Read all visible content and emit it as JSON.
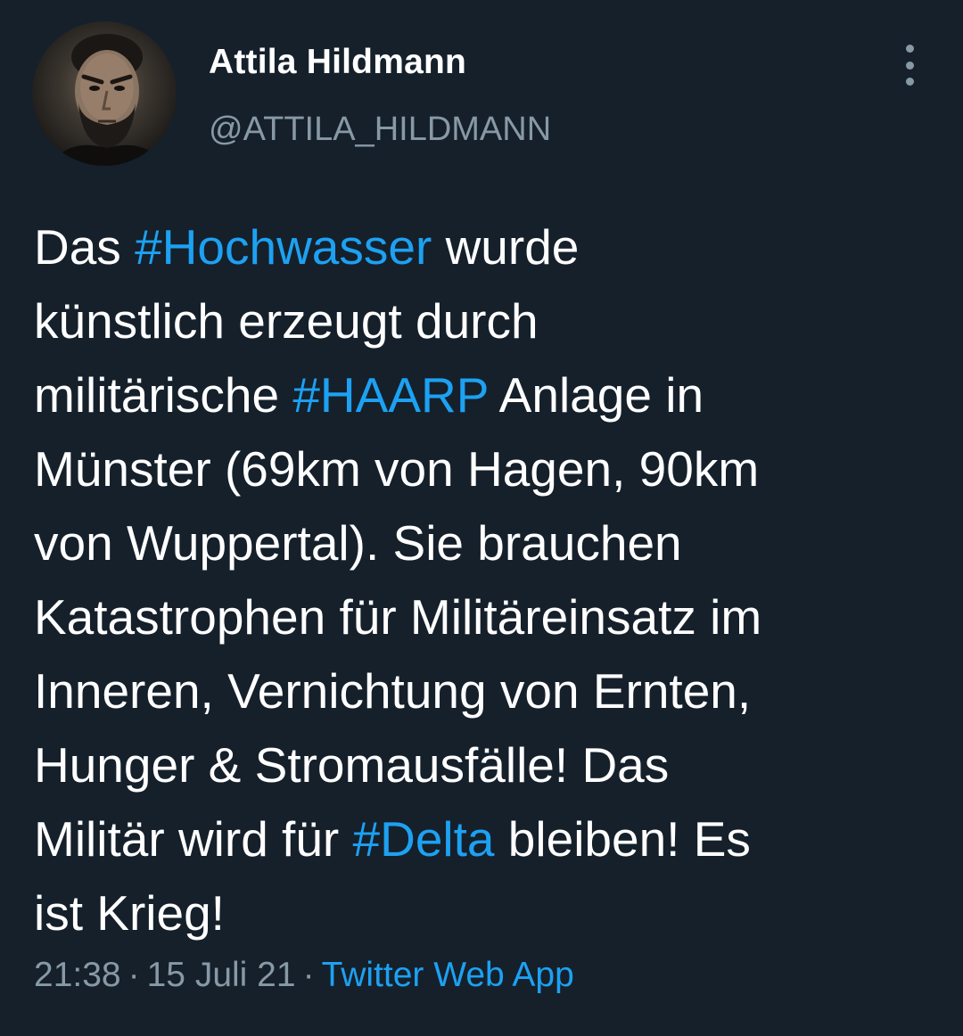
{
  "author": {
    "display_name": "Attila Hildmann",
    "handle": "@ATTILA_HILDMANN",
    "avatar": "avatar-photo"
  },
  "more_icon": "more-vertical-icon",
  "tweet": {
    "lines": [
      [
        {
          "t": "Das "
        },
        {
          "t": "#Hochwasser",
          "tag": true
        },
        {
          "t": " wurde"
        }
      ],
      [
        {
          "t": "künstlich erzeugt durch"
        }
      ],
      [
        {
          "t": "militärische "
        },
        {
          "t": "#HAARP",
          "tag": true
        },
        {
          "t": " Anlage in"
        }
      ],
      [
        {
          "t": "Münster (69km von Hagen, 90km"
        }
      ],
      [
        {
          "t": "von Wuppertal). Sie brauchen"
        }
      ],
      [
        {
          "t": "Katastrophen für Militäreinsatz im"
        }
      ],
      [
        {
          "t": "Inneren, Vernichtung von Ernten,"
        }
      ],
      [
        {
          "t": "Hunger & Stromausfälle! Das"
        }
      ],
      [
        {
          "t": "Militär wird für "
        },
        {
          "t": "#Delta",
          "tag": true
        },
        {
          "t": " bleiben! Es"
        }
      ],
      [
        {
          "t": "ist Krieg!"
        }
      ]
    ]
  },
  "meta": {
    "time": "21:38",
    "separator": "·",
    "date": "15 Juli 21",
    "source": "Twitter Web App"
  },
  "colors": {
    "background": "#15202b",
    "text": "#ffffff",
    "muted": "#8899a6",
    "link": "#1da1f2"
  }
}
